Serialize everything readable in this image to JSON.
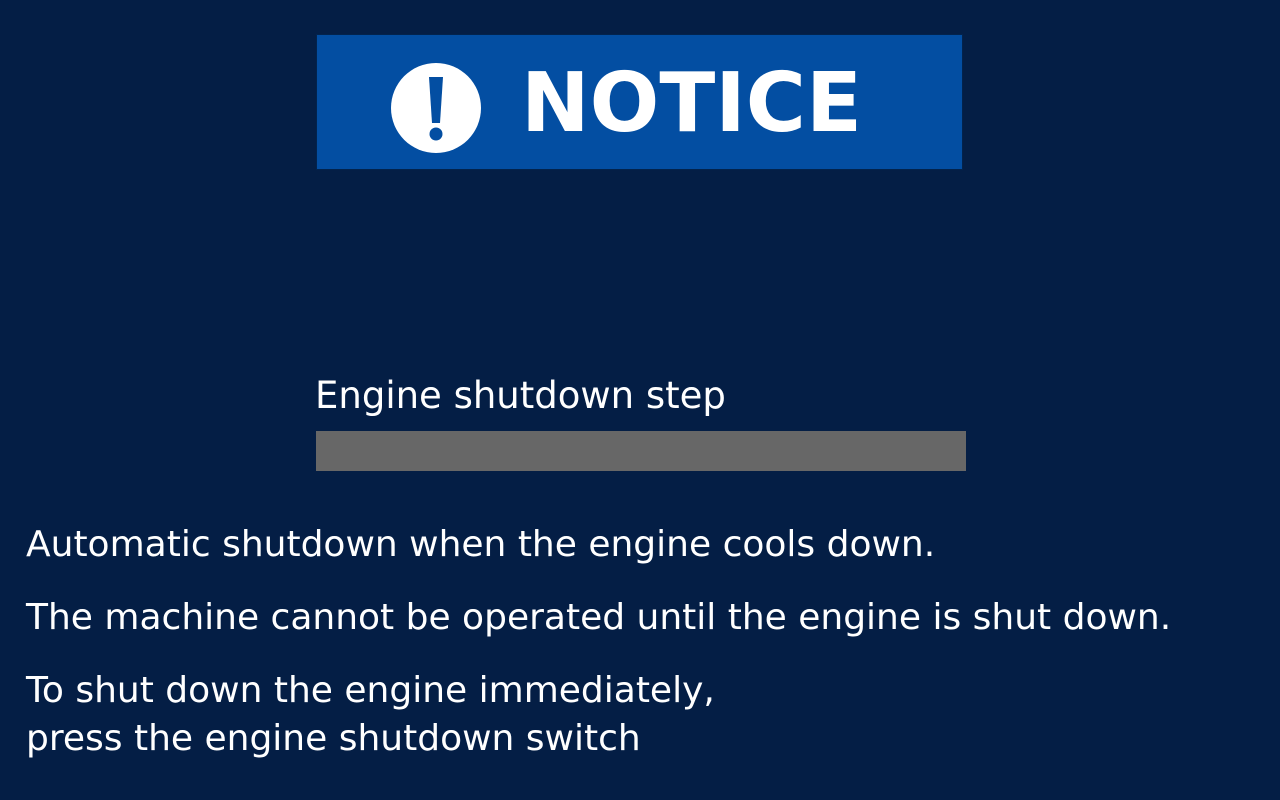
{
  "notice": {
    "title": "NOTICE",
    "icon": "exclamation-circle-icon",
    "banner_color": "#034EA2"
  },
  "shutdown_step": {
    "label": "Engine shutdown step",
    "progress": 0,
    "track_color": "#676767"
  },
  "messages": {
    "line1": "Automatic shutdown when the engine cools down.",
    "line2": "The machine cannot be operated until the engine is shut down.",
    "line3": "To shut down the engine immediately,",
    "line4": "press the engine shutdown switch"
  },
  "colors": {
    "background": "#041E45",
    "text": "#FFFFFF"
  }
}
